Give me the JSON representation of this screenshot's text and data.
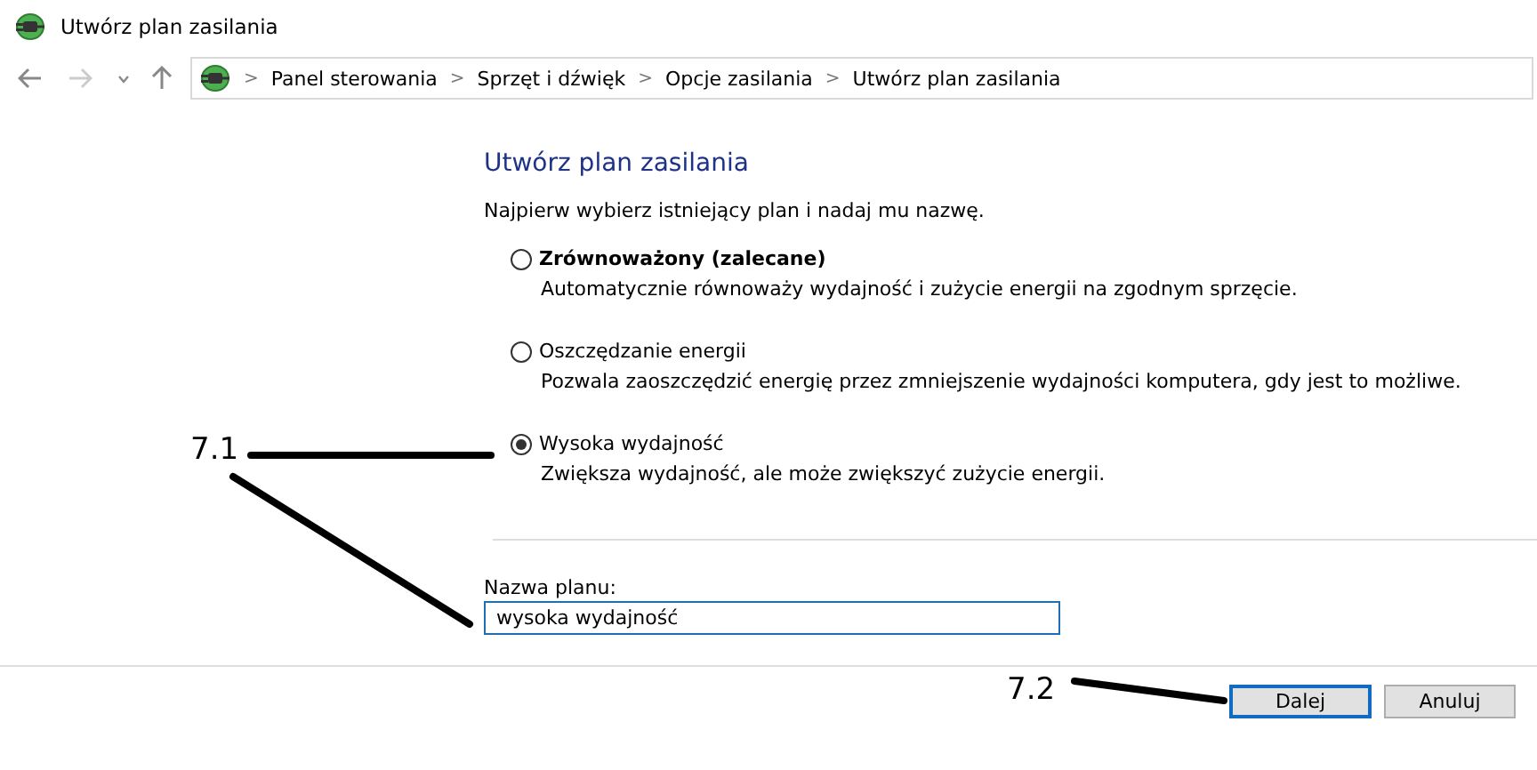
{
  "window": {
    "title": "Utwórz plan zasilania"
  },
  "address_bar": {
    "breadcrumbs": [
      "Panel sterowania",
      "Sprzęt i dźwięk",
      "Opcje zasilania",
      "Utwórz plan zasilania"
    ],
    "separator": ">"
  },
  "heading": "Utwórz plan zasilania",
  "intro": "Najpierw wybierz istniejący plan i nadaj mu nazwę.",
  "plans": [
    {
      "label": "Zrównoważony (zalecane)",
      "description": "Automatycznie równoważy wydajność i zużycie energii na zgodnym sprzęcie.",
      "selected": false,
      "bold": true
    },
    {
      "label": "Oszczędzanie energii",
      "description": "Pozwala zaoszczędzić energię przez zmniejszenie wydajności komputera, gdy jest to możliwe.",
      "selected": false,
      "bold": false
    },
    {
      "label": "Wysoka wydajność",
      "description": "Zwiększa wydajność, ale może zwiększyć zużycie energii.",
      "selected": true,
      "bold": false
    }
  ],
  "plan_name": {
    "label": "Nazwa planu:",
    "value": "wysoka wydajność"
  },
  "buttons": [
    {
      "label": "Dalej",
      "default": true
    },
    {
      "label": "Anuluj",
      "default": false
    }
  ],
  "annotations": [
    {
      "label": "7.1"
    },
    {
      "label": "7.2"
    }
  ]
}
